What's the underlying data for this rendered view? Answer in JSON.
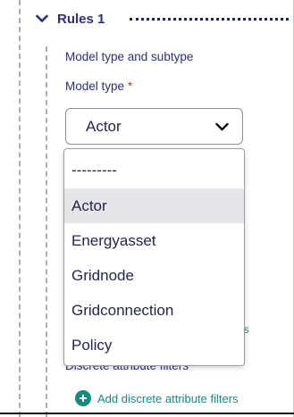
{
  "rule": {
    "title": "Rules 1",
    "section_label": "Model type and subtype",
    "field_label": "Model type",
    "required_mark": "*",
    "select_value": "Actor"
  },
  "dropdown": {
    "options": [
      "---------",
      "Actor",
      "Energyasset",
      "Gridnode",
      "Gridconnection",
      "Policy"
    ],
    "selected": "Actor"
  },
  "behind": {
    "link_tail": "ers",
    "discrete_label": "Discrete attribute filters",
    "add_discrete_label": "Add discrete attribute filters"
  },
  "colors": {
    "heading": "#2b2f7a",
    "accent": "#168a80",
    "required": "#d2323c"
  },
  "icons": {
    "rule_toggle": "chevron-down-icon",
    "select_caret": "chevron-down-icon",
    "add": "plus-circle-icon"
  }
}
